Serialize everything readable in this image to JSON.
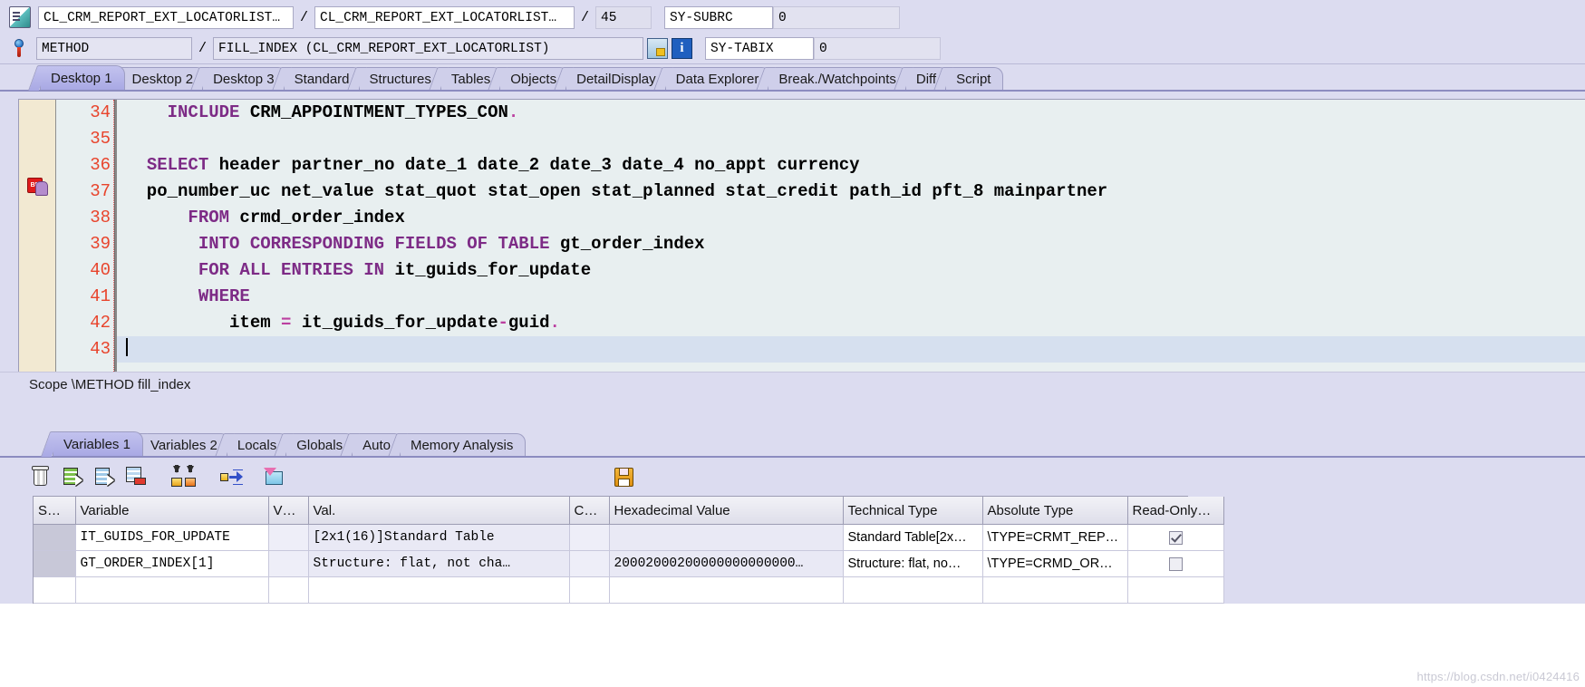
{
  "header": {
    "program_icon": "program-icon",
    "method_icon": "method-pin-icon",
    "program_name": "CL_CRM_REPORT_EXT_LOCATORLIST…",
    "include_name": "CL_CRM_REPORT_EXT_LOCATORLIST…",
    "line_number": "45",
    "sy_subrc_label": "SY-SUBRC",
    "sy_subrc_value": "0",
    "event_type": "METHOD",
    "event_name": "FILL_INDEX (CL_CRM_REPORT_EXT_LOCATORLIST)",
    "sy_tabix_label": "SY-TABIX",
    "sy_tabix_value": "0",
    "separator": "/",
    "stack_icon": "call-stack-icon",
    "info_icon": "information-icon"
  },
  "main_tabs": [
    {
      "label": "Desktop 1",
      "active": true
    },
    {
      "label": "Desktop 2",
      "active": false
    },
    {
      "label": "Desktop 3",
      "active": false
    },
    {
      "label": "Standard",
      "active": false
    },
    {
      "label": "Structures",
      "active": false
    },
    {
      "label": "Tables",
      "active": false
    },
    {
      "label": "Objects",
      "active": false
    },
    {
      "label": "DetailDisplay",
      "active": false
    },
    {
      "label": "Data Explorer",
      "active": false
    },
    {
      "label": "Break./Watchpoints",
      "active": false
    },
    {
      "label": "Diff",
      "active": false
    },
    {
      "label": "Script",
      "active": false
    }
  ],
  "editor": {
    "breakpoint_icon": "breakpoint-user-icon",
    "breakpoint_line": "36",
    "lines": [
      {
        "number": "34",
        "tokens": [
          {
            "t": "    ",
            "k": "plain"
          },
          {
            "t": "INCLUDE",
            "k": "kw"
          },
          {
            "t": " CRM_APPOINTMENT_TYPES_CON",
            "k": "plain"
          },
          {
            "t": ".",
            "k": "op"
          }
        ]
      },
      {
        "number": "35",
        "tokens": []
      },
      {
        "number": "36",
        "tokens": [
          {
            "t": "  ",
            "k": "plain"
          },
          {
            "t": "SELECT",
            "k": "kw"
          },
          {
            "t": " header partner_no date_1 date_2 date_3 date_4 no_appt currency",
            "k": "plain"
          }
        ]
      },
      {
        "number": "37",
        "tokens": [
          {
            "t": "  po_number_uc net_value stat_quot stat_open stat_planned stat_credit path_id pft_8 mainpartner",
            "k": "plain"
          }
        ]
      },
      {
        "number": "38",
        "tokens": [
          {
            "t": "      ",
            "k": "plain"
          },
          {
            "t": "FROM",
            "k": "kw"
          },
          {
            "t": " crmd_order_index",
            "k": "plain"
          }
        ]
      },
      {
        "number": "39",
        "tokens": [
          {
            "t": "       ",
            "k": "plain"
          },
          {
            "t": "INTO CORRESPONDING FIELDS OF TABLE",
            "k": "kw"
          },
          {
            "t": " gt_order_index",
            "k": "plain"
          }
        ]
      },
      {
        "number": "40",
        "tokens": [
          {
            "t": "       ",
            "k": "plain"
          },
          {
            "t": "FOR ALL ENTRIES IN",
            "k": "kw"
          },
          {
            "t": " it_guids_for_update",
            "k": "plain"
          }
        ]
      },
      {
        "number": "41",
        "tokens": [
          {
            "t": "       ",
            "k": "plain"
          },
          {
            "t": "WHERE",
            "k": "kw"
          }
        ]
      },
      {
        "number": "42",
        "tokens": [
          {
            "t": "          item ",
            "k": "plain"
          },
          {
            "t": "=",
            "k": "op"
          },
          {
            "t": " it_guids_for_update",
            "k": "plain"
          },
          {
            "t": "-",
            "k": "op"
          },
          {
            "t": "guid",
            "k": "plain"
          },
          {
            "t": ".",
            "k": "op"
          }
        ]
      },
      {
        "number": "43",
        "tokens": [],
        "cursor": true
      }
    ]
  },
  "scope": {
    "text": "Scope \\METHOD fill_index"
  },
  "lower_tabs": [
    {
      "label": "Variables 1",
      "active": true
    },
    {
      "label": "Variables 2",
      "active": false
    },
    {
      "label": "Locals",
      "active": false
    },
    {
      "label": "Globals",
      "active": false
    },
    {
      "label": "Auto",
      "active": false
    },
    {
      "label": "Memory Analysis",
      "active": false
    }
  ],
  "toolbar": [
    {
      "icon": "delete-trash-icon"
    },
    {
      "icon": "copy-list-green-icon"
    },
    {
      "icon": "copy-list-blue-icon"
    },
    {
      "icon": "remove-row-icon"
    },
    {
      "icon": "import-variables-icon"
    },
    {
      "icon": "move-variables-icon"
    },
    {
      "icon": "new-folder-icon"
    },
    {
      "icon": "save-layout-icon"
    }
  ],
  "vars_table": {
    "columns": [
      "S…",
      "Variable",
      "V…",
      "Val.",
      "C…",
      "Hexadecimal Value",
      "Technical Type",
      "Absolute Type",
      "Read-Only…"
    ],
    "rows": [
      {
        "sel": "",
        "variable": "IT_GUIDS_FOR_UPDATE",
        "v": "",
        "val": "[2x1(16)]Standard Table",
        "c": "",
        "hex": "",
        "technical_type": "Standard Table[2x…",
        "absolute_type": "\\TYPE=CRMT_REP…",
        "read_only": true
      },
      {
        "sel": "",
        "variable": "GT_ORDER_INDEX[1]",
        "v": "",
        "val": "Structure: flat, not cha…",
        "c": "",
        "hex": "20002000200000000000000…",
        "technical_type": "Structure: flat, no…",
        "absolute_type": "\\TYPE=CRMD_OR…",
        "read_only": false
      },
      {
        "sel": "",
        "variable": "",
        "v": "",
        "val": "",
        "c": "",
        "hex": "",
        "technical_type": "",
        "absolute_type": "",
        "read_only": null
      }
    ]
  },
  "watermark": "https://blog.csdn.net/i0424416"
}
